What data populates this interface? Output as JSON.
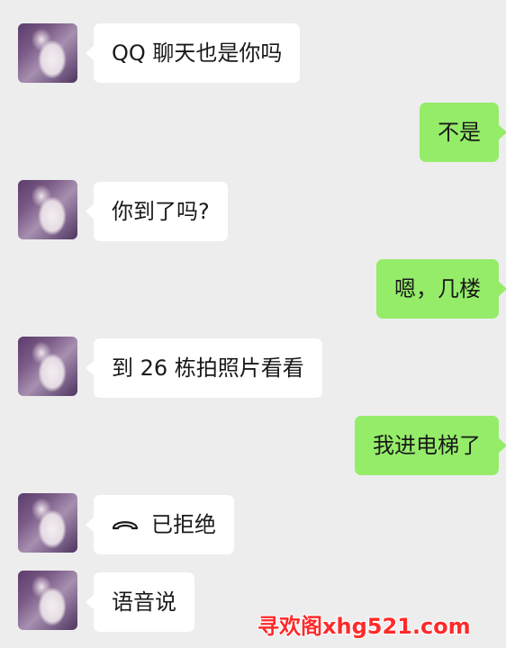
{
  "chat": {
    "messages": [
      {
        "side": "in",
        "text": "QQ 聊天也是你吗"
      },
      {
        "side": "out",
        "text": "不是"
      },
      {
        "side": "in",
        "text": "你到了吗?"
      },
      {
        "side": "out",
        "text": "嗯，几楼"
      },
      {
        "side": "in",
        "text": "到 26 栋拍照片看看"
      },
      {
        "side": "out",
        "text": "我进电梯了"
      },
      {
        "side": "in",
        "text": "已拒绝",
        "icon": "call-declined-icon"
      },
      {
        "side": "in",
        "text": "语音说"
      }
    ]
  },
  "watermark": {
    "text": "寻欢阁xhg521.com",
    "color": "#ff2a2a"
  },
  "colors": {
    "background": "#ededed",
    "incoming_bubble": "#ffffff",
    "outgoing_bubble": "#95ec69"
  }
}
